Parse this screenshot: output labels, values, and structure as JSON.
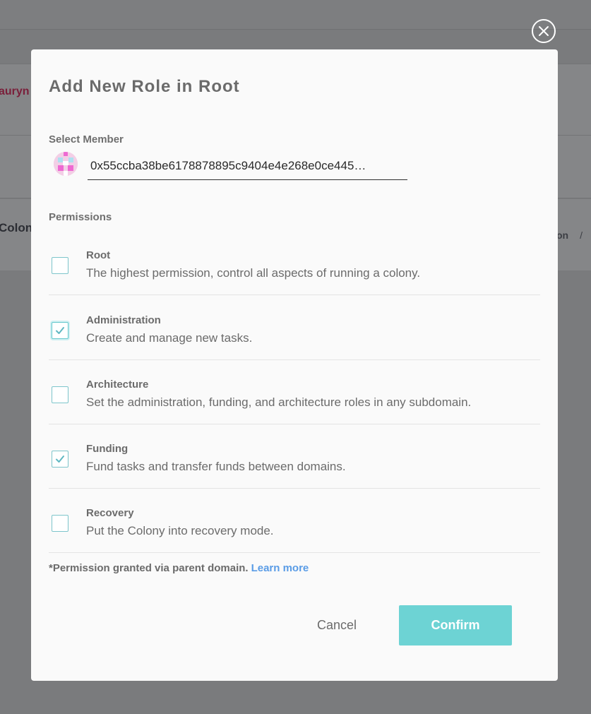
{
  "background": {
    "user_name": "auryn",
    "colony_name": "Colony",
    "breadcrumb_fragment": "on",
    "breadcrumb_separator": "/"
  },
  "modal": {
    "title": "Add New Role in Root",
    "select_member_label": "Select Member",
    "member_value": "0x55ccba38be6178878895c9404e4e268e0ce445…",
    "permissions_label": "Permissions",
    "permissions": [
      {
        "name": "Root",
        "description": "The highest permission, control all aspects of running a colony.",
        "checked": false
      },
      {
        "name": "Administration",
        "description": "Create and manage new tasks.",
        "checked": true
      },
      {
        "name": "Architecture",
        "description": "Set the administration, funding, and architecture roles in any subdomain.",
        "checked": false
      },
      {
        "name": "Funding",
        "description": "Fund tasks and transfer funds between domains.",
        "checked": true
      },
      {
        "name": "Recovery",
        "description": "Put the Colony into recovery mode.",
        "checked": false
      }
    ],
    "note_text": "*Permission granted via parent domain.",
    "learn_more": "Learn more",
    "cancel_label": "Cancel",
    "confirm_label": "Confirm"
  },
  "icons": {
    "close": "close-icon",
    "check": "check-icon"
  },
  "colors": {
    "accent": "#6dd3d4",
    "link": "#5a9ce6",
    "checkbox_border": "#7dc5cb",
    "overlay": "#7a7b7d"
  }
}
